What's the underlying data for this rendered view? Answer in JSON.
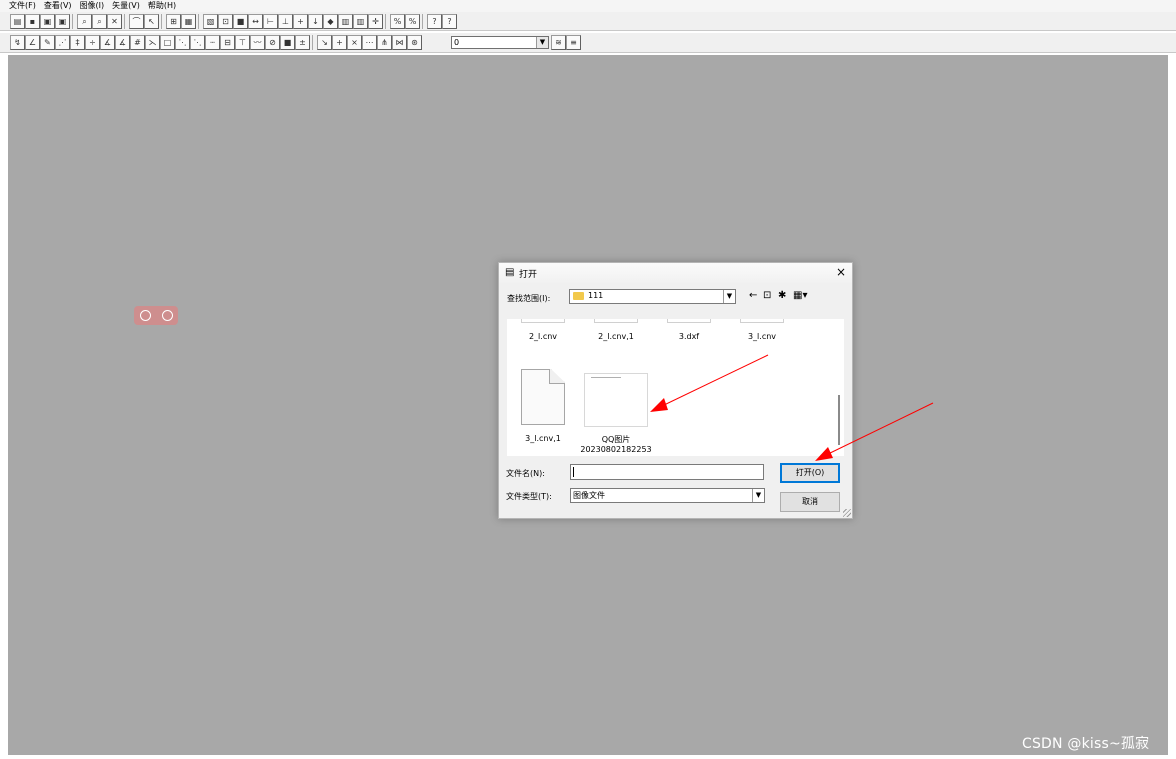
{
  "menu": [
    "文件(F)",
    "查看(V)",
    "图像(I)",
    "矢量(V)",
    "帮助(H)"
  ],
  "toolbar": {
    "layer_value": "0"
  },
  "dialog": {
    "title": "打开",
    "look_in_label": "查找范围(I):",
    "look_in_value": "111",
    "files_row1": [
      "2_l.cnv",
      "2_l.cnv,1",
      "3.dxf",
      "3_l.cnv"
    ],
    "file_doc_name": "3_l.cnv,1",
    "file_image_name_line1": "QQ图片",
    "file_image_name_line2": "20230802182253",
    "filename_label": "文件名(N):",
    "filename_value": "",
    "filetype_label": "文件类型(T):",
    "filetype_value": "图像文件",
    "open_label": "打开(O)",
    "cancel_label": "取消"
  },
  "watermark": "CSDN @kiss~孤寂",
  "colors": {
    "workspace": "#a8a8a8",
    "annotation": "#ff0000",
    "focus": "#0078d7"
  }
}
